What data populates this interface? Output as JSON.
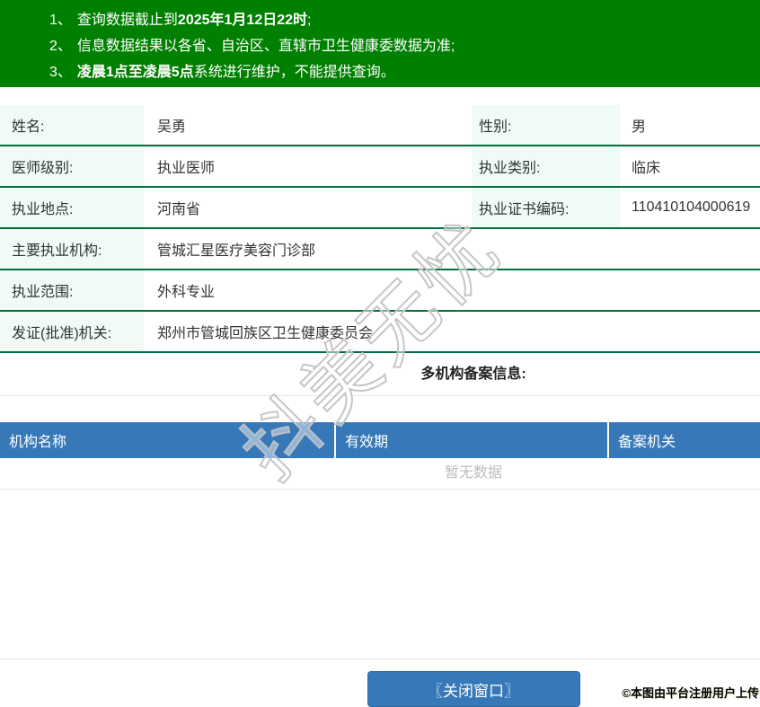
{
  "banner": {
    "lines": [
      {
        "num": "1、",
        "pre": "查询数据截止到",
        "bold": "2025年1月12日22时",
        "post": ";"
      },
      {
        "num": "2、",
        "pre": "信息数据结果以各省、自治区、直辖市卫生健康委数据为准;",
        "bold": "",
        "post": ""
      },
      {
        "num": "3、",
        "pre": "",
        "bold": "凌晨1点至凌晨5点",
        "post": "系统进行维护，不能提供查询。"
      }
    ]
  },
  "profile": {
    "rows": [
      {
        "label1": "姓名:",
        "value1": "吴勇",
        "label2": "性别:",
        "value2": "男"
      },
      {
        "label1": "医师级别:",
        "value1": "执业医师",
        "label2": "执业类别:",
        "value2": "临床"
      },
      {
        "label1": "执业地点:",
        "value1": "河南省",
        "label2": "执业证书编码:",
        "value2": "110410104000619"
      },
      {
        "label1": "主要执业机构:",
        "value1": "管城汇星医疗美容门诊部"
      },
      {
        "label1": "执业范围:",
        "value1": "外科专业"
      },
      {
        "label1": "发证(批准)机关:",
        "value1": "郑州市管城回族区卫生健康委员会"
      }
    ]
  },
  "filing": {
    "title": "多机构备案信息:",
    "columns": [
      "机构名称",
      "有效期",
      "备案机关"
    ],
    "empty_text": "暂无数据"
  },
  "footer": {
    "close_button": "〖关闭窗口〗",
    "credit": "©本图由平台注册用户上传"
  },
  "watermark": "抖美无忧",
  "colors": {
    "banner_green": "#008000",
    "row_border_green": "#00703e",
    "label_cell_bg": "#effbf4",
    "header_blue": "#3779b8",
    "button_blue": "#3779b8",
    "light_border": "#e8e8e8",
    "empty_text_gray": "#bdbdbd"
  }
}
